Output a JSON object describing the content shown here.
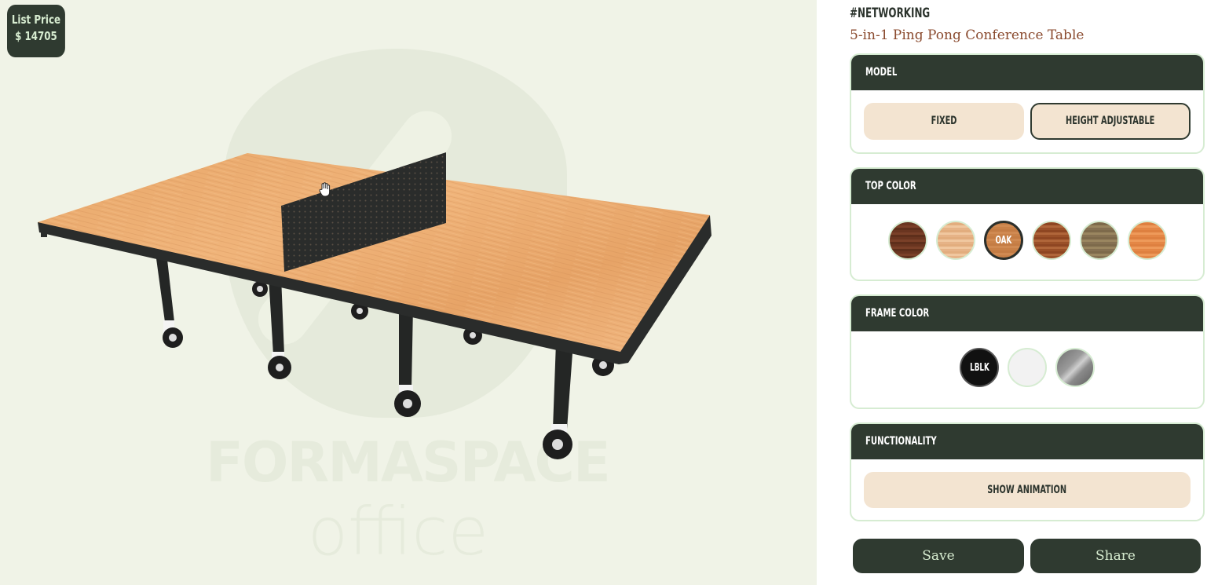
{
  "viewer": {
    "price_label": "List Price",
    "price_value": "$ 14705",
    "watermark_line1": "FORMASPACE",
    "watermark_line2": "office",
    "cursor_icon": "grab-hand-icon"
  },
  "panel": {
    "tag": "#NETWORKING",
    "product_name": "5-in-1 Ping Pong Conference Table",
    "sections": {
      "model": {
        "title": "MODEL",
        "options": [
          {
            "label": "FIXED",
            "selected": false
          },
          {
            "label": "HEIGHT ADJUSTABLE",
            "selected": true
          }
        ]
      },
      "top_color": {
        "title": "TOP COLOR",
        "swatches": [
          {
            "name": "dark-walnut",
            "label": "",
            "color": "#6e3a22",
            "selected": false
          },
          {
            "name": "maple",
            "label": "",
            "color": "#e8b98a",
            "selected": false
          },
          {
            "name": "oak",
            "label": "OAK",
            "color": "#c9844c",
            "selected": true
          },
          {
            "name": "cherry",
            "label": "",
            "color": "#a4592f",
            "selected": false
          },
          {
            "name": "driftwood",
            "label": "",
            "color": "#8f7a55",
            "selected": false
          },
          {
            "name": "amber",
            "label": "",
            "color": "#e58c4a",
            "selected": false
          }
        ]
      },
      "frame_color": {
        "title": "FRAME COLOR",
        "swatches": [
          {
            "name": "black",
            "label": "LBLK",
            "color": "#111111",
            "selected": true
          },
          {
            "name": "white",
            "label": "",
            "color": "#f2f2f2",
            "selected": false
          },
          {
            "name": "silver",
            "label": "",
            "color": "#8e8e8e",
            "selected": false
          }
        ]
      },
      "functionality": {
        "title": "FUNCTIONALITY",
        "button_label": "SHOW ANIMATION"
      }
    },
    "actions": {
      "save_label": "Save",
      "share_label": "Share"
    }
  },
  "colors": {
    "dark_green": "#2f3a30",
    "button_cream": "#f3e4d1",
    "card_border": "#d6ecd2",
    "product_name": "#8a4a2e",
    "viewer_bg": "#f0f3e7"
  }
}
